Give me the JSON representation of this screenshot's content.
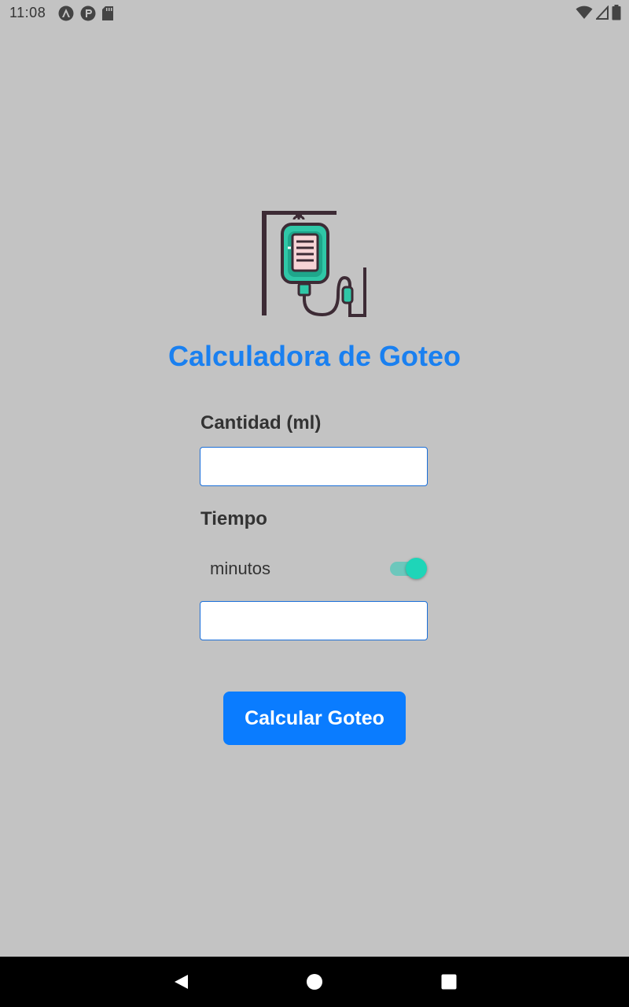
{
  "status_bar": {
    "time": "11:08",
    "left_icons": [
      "android-studio-icon",
      "pocket-icon",
      "sd-card-icon"
    ],
    "right_icons": [
      "wifi-icon",
      "cell-signal-icon",
      "battery-icon"
    ]
  },
  "app": {
    "logo_icon": "iv-drip-icon",
    "title": "Calculadora de Goteo",
    "quantity_label": "Cantidad (ml)",
    "quantity_value": "",
    "time_label": "Tiempo",
    "unit_toggle_label": "minutos",
    "unit_toggle_on": true,
    "time_value": "",
    "calculate_button": "Calcular Goteo"
  },
  "colors": {
    "background": "#c3c3c3",
    "title": "#1a80f0",
    "button": "#0a7cff",
    "switch_thumb": "#1ed5b8",
    "switch_track": "#5ec8bb",
    "input_border": "#1a6ed8"
  },
  "nav_bar": {
    "back_icon": "back-triangle-icon",
    "home_icon": "home-circle-icon",
    "recents_icon": "recents-square-icon"
  }
}
